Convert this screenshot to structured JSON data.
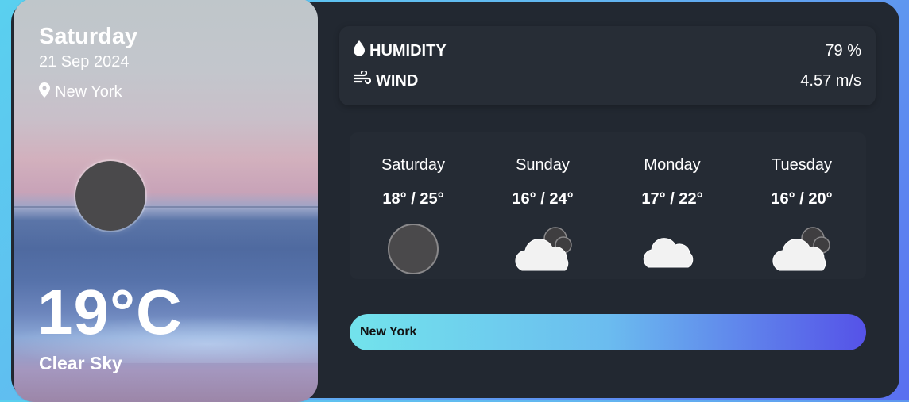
{
  "current": {
    "day": "Saturday",
    "date": "21 Sep 2024",
    "location": "New York",
    "temperature": "19°C",
    "condition": "Clear Sky",
    "icon": "moon-icon"
  },
  "stats": {
    "humidity_label": "HUMIDITY",
    "humidity_value": "79 %",
    "wind_label": "WIND",
    "wind_value": "4.57 m/s"
  },
  "forecast": [
    {
      "day": "Saturday",
      "temp": "18° / 25°",
      "icon": "moon-icon"
    },
    {
      "day": "Sunday",
      "temp": "16° / 24°",
      "icon": "cloudy-night-icon"
    },
    {
      "day": "Monday",
      "temp": "17° / 22°",
      "icon": "cloud-icon"
    },
    {
      "day": "Tuesday",
      "temp": "16° / 20°",
      "icon": "cloudy-night-icon"
    }
  ],
  "search": {
    "value": "New York"
  },
  "colors": {
    "panel": "#222831",
    "accent_start": "#72e3ec",
    "accent_end": "#5552e8"
  }
}
